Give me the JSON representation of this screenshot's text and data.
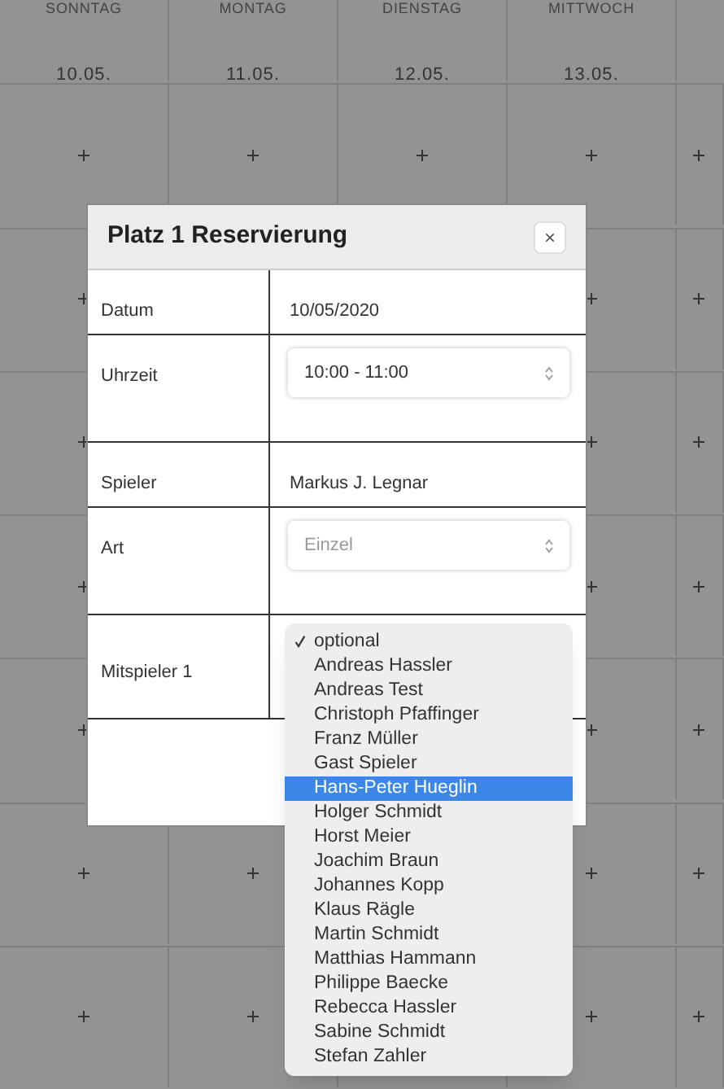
{
  "calendar": {
    "days": [
      {
        "name": "SONNTAG",
        "date": "10.05."
      },
      {
        "name": "MONTAG",
        "date": "11.05."
      },
      {
        "name": "DIENSTAG",
        "date": "12.05."
      },
      {
        "name": "MITTWOCH",
        "date": "13.05."
      }
    ]
  },
  "modal": {
    "title": "Platz 1 Reservierung",
    "close": "×",
    "rows": [
      {
        "kind": "text",
        "label": "Datum",
        "value": "10/05/2020"
      },
      {
        "kind": "select",
        "label": "Uhrzeit",
        "value": "10:00 - 11:00",
        "disabled": false
      },
      {
        "kind": "text",
        "label": "Spieler",
        "value": "Markus J. Legnar"
      },
      {
        "kind": "select",
        "label": "Art",
        "value": "Einzel",
        "disabled": true
      },
      {
        "kind": "dropdown",
        "label": "Mitspieler 1"
      }
    ]
  },
  "dropdown": {
    "items": [
      {
        "label": "optional",
        "checked": true,
        "selected": false
      },
      {
        "label": "Andreas Hassler",
        "checked": false,
        "selected": false
      },
      {
        "label": "Andreas Test",
        "checked": false,
        "selected": false
      },
      {
        "label": "Christoph Pfaffinger",
        "checked": false,
        "selected": false
      },
      {
        "label": "Franz Müller",
        "checked": false,
        "selected": false
      },
      {
        "label": "Gast Spieler",
        "checked": false,
        "selected": false
      },
      {
        "label": "Hans-Peter Hueglin",
        "checked": false,
        "selected": true
      },
      {
        "label": "Holger Schmidt",
        "checked": false,
        "selected": false
      },
      {
        "label": "Horst Meier",
        "checked": false,
        "selected": false
      },
      {
        "label": "Joachim Braun",
        "checked": false,
        "selected": false
      },
      {
        "label": "Johannes Kopp",
        "checked": false,
        "selected": false
      },
      {
        "label": "Klaus Rägle",
        "checked": false,
        "selected": false
      },
      {
        "label": "Martin Schmidt",
        "checked": false,
        "selected": false
      },
      {
        "label": "Matthias Hammann",
        "checked": false,
        "selected": false
      },
      {
        "label": "Philippe Baecke",
        "checked": false,
        "selected": false
      },
      {
        "label": "Rebecca Hassler",
        "checked": false,
        "selected": false
      },
      {
        "label": "Sabine Schmidt",
        "checked": false,
        "selected": false
      },
      {
        "label": "Stefan Zahler",
        "checked": false,
        "selected": false
      }
    ]
  }
}
